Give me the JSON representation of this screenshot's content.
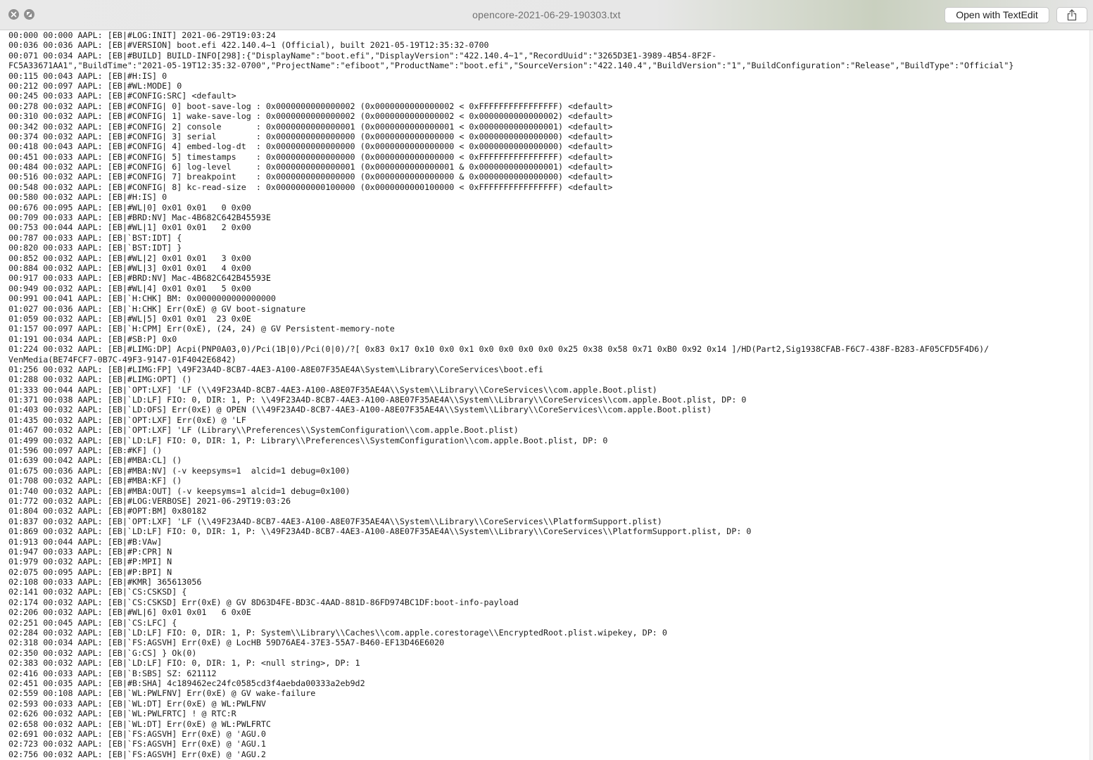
{
  "window": {
    "title": "opencore-2021-06-29-190303.txt",
    "open_button_label": "Open with TextEdit",
    "controls": [
      "close-icon",
      "minimize-icon"
    ],
    "share_icon": "share-icon"
  },
  "log_lines": [
    "00:000 00:000 AAPL: [EB|#LOG:INIT] 2021-06-29T19:03:24",
    "00:036 00:036 AAPL: [EB|#VERSION] boot.efi 422.140.4~1 (Official), built 2021-05-19T12:35:32-0700",
    "00:071 00:034 AAPL: [EB|#BUILD] BUILD-INFO[298]:{\"DisplayName\":\"boot.efi\",\"DisplayVersion\":\"422.140.4~1\",\"RecordUuid\":\"3265D3E1-3989-4B54-8F2F-",
    "FC5A33671AA1\",\"BuildTime\":\"2021-05-19T12:35:32-0700\",\"ProjectName\":\"efiboot\",\"ProductName\":\"boot.efi\",\"SourceVersion\":\"422.140.4\",\"BuildVersion\":\"1\",\"BuildConfiguration\":\"Release\",\"BuildType\":\"Official\"}",
    "00:115 00:043 AAPL: [EB|#H:IS] 0",
    "00:212 00:097 AAPL: [EB|#WL:MODE] 0",
    "00:245 00:033 AAPL: [EB|#CONFIG:SRC] <default>",
    "00:278 00:032 AAPL: [EB|#CONFIG| 0] boot-save-log : 0x0000000000000002 (0x0000000000000002 < 0xFFFFFFFFFFFFFFFF) <default>",
    "00:310 00:032 AAPL: [EB|#CONFIG| 1] wake-save-log : 0x0000000000000002 (0x0000000000000002 < 0x0000000000000002) <default>",
    "00:342 00:032 AAPL: [EB|#CONFIG| 2] console       : 0x0000000000000001 (0x0000000000000001 < 0x0000000000000001) <default>",
    "00:374 00:032 AAPL: [EB|#CONFIG| 3] serial        : 0x0000000000000000 (0x0000000000000000 < 0x0000000000000000) <default>",
    "00:418 00:043 AAPL: [EB|#CONFIG| 4] embed-log-dt  : 0x0000000000000000 (0x0000000000000000 < 0x0000000000000000) <default>",
    "00:451 00:033 AAPL: [EB|#CONFIG| 5] timestamps    : 0x0000000000000000 (0x0000000000000000 < 0xFFFFFFFFFFFFFFFF) <default>",
    "00:484 00:032 AAPL: [EB|#CONFIG| 6] log-level     : 0x0000000000000001 (0x0000000000000001 & 0x0000000000000001) <default>",
    "00:516 00:032 AAPL: [EB|#CONFIG| 7] breakpoint    : 0x0000000000000000 (0x0000000000000000 & 0x0000000000000000) <default>",
    "00:548 00:032 AAPL: [EB|#CONFIG| 8] kc-read-size  : 0x0000000000100000 (0x0000000000100000 < 0xFFFFFFFFFFFFFFFF) <default>",
    "00:580 00:032 AAPL: [EB|#H:IS] 0",
    "00:676 00:095 AAPL: [EB|#WL|0] 0x01 0x01   0 0x00",
    "00:709 00:033 AAPL: [EB|#BRD:NV] Mac-4B682C642B45593E",
    "00:753 00:044 AAPL: [EB|#WL|1] 0x01 0x01   2 0x00",
    "00:787 00:033 AAPL: [EB|`BST:IDT] {",
    "00:820 00:033 AAPL: [EB|`BST:IDT] }",
    "00:852 00:032 AAPL: [EB|#WL|2] 0x01 0x01   3 0x00",
    "00:884 00:032 AAPL: [EB|#WL|3] 0x01 0x01   4 0x00",
    "00:917 00:033 AAPL: [EB|#BRD:NV] Mac-4B682C642B45593E",
    "00:949 00:032 AAPL: [EB|#WL|4] 0x01 0x01   5 0x00",
    "00:991 00:041 AAPL: [EB|`H:CHK] BM: 0x0000000000000000",
    "01:027 00:036 AAPL: [EB|`H:CHK] Err(0xE) @ GV boot-signature",
    "01:059 00:032 AAPL: [EB|#WL|5] 0x01 0x01  23 0x0E",
    "01:157 00:097 AAPL: [EB|`H:CPM] Err(0xE), (24, 24) @ GV Persistent-memory-note",
    "01:191 00:034 AAPL: [EB|#SB:P] 0x0",
    "01:224 00:032 AAPL: [EB|#LIMG:DP] Acpi(PNP0A03,0)/Pci(1B|0)/Pci(0|0)/?[ 0x83 0x17 0x10 0x0 0x1 0x0 0x0 0x0 0x0 0x25 0x38 0x58 0x71 0xB0 0x92 0x14 ]/HD(Part2,Sig1938CFAB-F6C7-438F-B283-AF05CFD5F4D6)/",
    "VenMedia(BE74FCF7-0B7C-49F3-9147-01F4042E6842)",
    "01:256 00:032 AAPL: [EB|#LIMG:FP] \\49F23A4D-8CB7-4AE3-A100-A8E07F35AE4A\\System\\Library\\CoreServices\\boot.efi",
    "01:288 00:032 AAPL: [EB|#LIMG:OPT] ()",
    "01:333 00:044 AAPL: [EB|`OPT:LXF] 'LF (\\\\49F23A4D-8CB7-4AE3-A100-A8E07F35AE4A\\\\System\\\\Library\\\\CoreServices\\\\com.apple.Boot.plist)",
    "01:371 00:038 AAPL: [EB|`LD:LF] FIO: 0, DIR: 1, P: \\\\49F23A4D-8CB7-4AE3-A100-A8E07F35AE4A\\\\System\\\\Library\\\\CoreServices\\\\com.apple.Boot.plist, DP: 0",
    "01:403 00:032 AAPL: [EB|`LD:OFS] Err(0xE) @ OPEN (\\\\49F23A4D-8CB7-4AE3-A100-A8E07F35AE4A\\\\System\\\\Library\\\\CoreServices\\\\com.apple.Boot.plist)",
    "01:435 00:032 AAPL: [EB|`OPT:LXF] Err(0xE) @ 'LF",
    "01:467 00:032 AAPL: [EB|`OPT:LXF] 'LF (Library\\\\Preferences\\\\SystemConfiguration\\\\com.apple.Boot.plist)",
    "01:499 00:032 AAPL: [EB|`LD:LF] FIO: 0, DIR: 1, P: Library\\\\Preferences\\\\SystemConfiguration\\\\com.apple.Boot.plist, DP: 0",
    "01:596 00:097 AAPL: [EB:#KF] ()",
    "01:639 00:042 AAPL: [EB|#MBA:CL] ()",
    "01:675 00:036 AAPL: [EB|#MBA:NV] (-v keepsyms=1  alcid=1 debug=0x100)",
    "01:708 00:032 AAPL: [EB|#MBA:KF] ()",
    "01:740 00:032 AAPL: [EB|#MBA:OUT] (-v keepsyms=1 alcid=1 debug=0x100)",
    "01:772 00:032 AAPL: [EB|#LOG:VERBOSE] 2021-06-29T19:03:26",
    "01:804 00:032 AAPL: [EB|#OPT:BM] 0x80182",
    "01:837 00:032 AAPL: [EB|`OPT:LXF] 'LF (\\\\49F23A4D-8CB7-4AE3-A100-A8E07F35AE4A\\\\System\\\\Library\\\\CoreServices\\\\PlatformSupport.plist)",
    "01:869 00:032 AAPL: [EB|`LD:LF] FIO: 0, DIR: 1, P: \\\\49F23A4D-8CB7-4AE3-A100-A8E07F35AE4A\\\\System\\\\Library\\\\CoreServices\\\\PlatformSupport.plist, DP: 0",
    "01:913 00:044 AAPL: [EB|#B:VAw]",
    "01:947 00:033 AAPL: [EB|#P:CPR] N",
    "01:979 00:032 AAPL: [EB|#P:MPI] N",
    "02:075 00:095 AAPL: [EB|#P:BPI] N",
    "02:108 00:033 AAPL: [EB|#KMR] 365613056",
    "02:141 00:032 AAPL: [EB|`CS:CSKSD] {",
    "02:174 00:032 AAPL: [EB|`CS:CSKSD] Err(0xE) @ GV 8D63D4FE-BD3C-4AAD-881D-86FD974BC1DF:boot-info-payload",
    "02:206 00:032 AAPL: [EB|#WL|6] 0x01 0x01   6 0x0E",
    "02:251 00:045 AAPL: [EB|`CS:LFC] {",
    "02:284 00:032 AAPL: [EB|`LD:LF] FIO: 0, DIR: 1, P: System\\\\Library\\\\Caches\\\\com.apple.corestorage\\\\EncryptedRoot.plist.wipekey, DP: 0",
    "02:318 00:034 AAPL: [EB|`FS:AGSVH] Err(0xE) @ LocHB 59D76AE4-37E3-55A7-B460-EF13D46E6020",
    "02:350 00:032 AAPL: [EB|`G:CS] } Ok(0)",
    "02:383 00:032 AAPL: [EB|`LD:LF] FIO: 0, DIR: 1, P: <null string>, DP: 1",
    "02:416 00:033 AAPL: [EB|`B:SBS] SZ: 621112",
    "02:451 00:035 AAPL: [EB|#B:SHA] 4c189462ec24fc0585cd3f4aebda00333a2eb9d2",
    "02:559 00:108 AAPL: [EB|`WL:PWLFNV] Err(0xE) @ GV wake-failure",
    "02:593 00:033 AAPL: [EB|`WL:DT] Err(0xE) @ WL:PWLFNV",
    "02:626 00:032 AAPL: [EB|`WL:PWLFRTC] ! @ RTC:R",
    "02:658 00:032 AAPL: [EB|`WL:DT] Err(0xE) @ WL:PWLFRTC",
    "02:691 00:032 AAPL: [EB|`FS:AGSVH] Err(0xE) @ 'AGU.0",
    "02:723 00:032 AAPL: [EB|`FS:AGSVH] Err(0xE) @ 'AGU.1",
    "02:756 00:032 AAPL: [EB|`FS:AGSVH] Err(0xE) @ 'AGU.2"
  ]
}
